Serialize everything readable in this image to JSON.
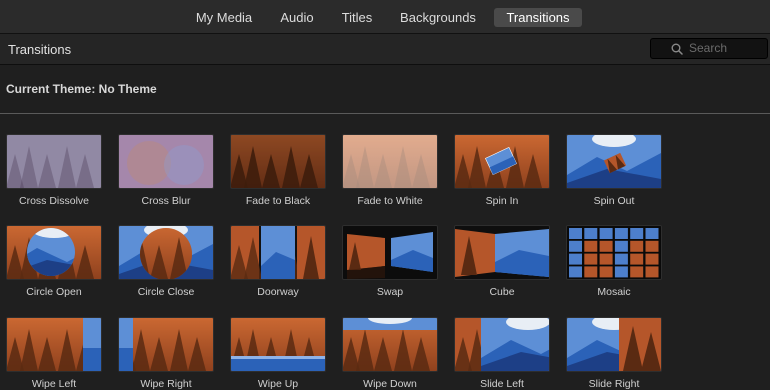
{
  "tabs": [
    {
      "label": "My Media",
      "active": false
    },
    {
      "label": "Audio",
      "active": false
    },
    {
      "label": "Titles",
      "active": false
    },
    {
      "label": "Backgrounds",
      "active": false
    },
    {
      "label": "Transitions",
      "active": true
    }
  ],
  "header": {
    "title": "Transitions",
    "search_placeholder": "Search"
  },
  "theme_label": "Current Theme: No Theme",
  "colors": {
    "forest": "#b5562a",
    "mountain_blue": "#2b62b8",
    "background": "#1f1f1f"
  },
  "transitions": [
    {
      "label": "Cross Dissolve",
      "icon": "cross-dissolve"
    },
    {
      "label": "Cross Blur",
      "icon": "cross-blur"
    },
    {
      "label": "Fade to Black",
      "icon": "fade-to-black"
    },
    {
      "label": "Fade to White",
      "icon": "fade-to-white"
    },
    {
      "label": "Spin In",
      "icon": "spin-in"
    },
    {
      "label": "Spin Out",
      "icon": "spin-out"
    },
    {
      "label": "Circle Open",
      "icon": "circle-open"
    },
    {
      "label": "Circle Close",
      "icon": "circle-close"
    },
    {
      "label": "Doorway",
      "icon": "doorway"
    },
    {
      "label": "Swap",
      "icon": "swap"
    },
    {
      "label": "Cube",
      "icon": "cube"
    },
    {
      "label": "Mosaic",
      "icon": "mosaic"
    },
    {
      "label": "Wipe Left",
      "icon": "wipe-left"
    },
    {
      "label": "Wipe Right",
      "icon": "wipe-right"
    },
    {
      "label": "Wipe Up",
      "icon": "wipe-up"
    },
    {
      "label": "Wipe Down",
      "icon": "wipe-down"
    },
    {
      "label": "Slide Left",
      "icon": "slide-left"
    },
    {
      "label": "Slide Right",
      "icon": "slide-right"
    }
  ]
}
